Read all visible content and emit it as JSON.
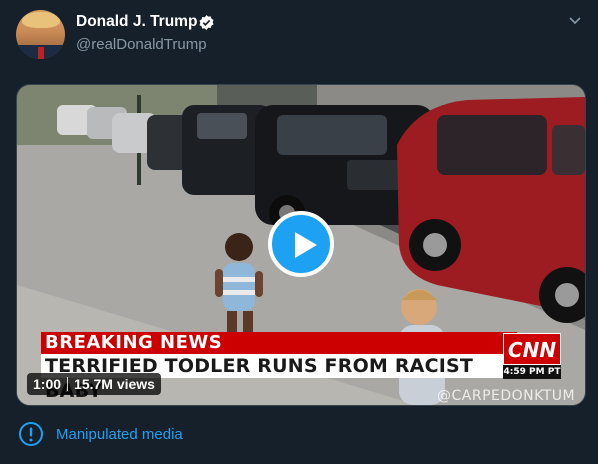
{
  "tweet": {
    "display_name": "Donald J. Trump",
    "handle": "@realDonaldTrump",
    "verified": true,
    "avatar_icon": "avatar-photo",
    "menu_icon": "chevron-down-icon"
  },
  "video": {
    "banner_top": "BREAKING NEWS",
    "banner_bottom": "TERRIFIED TODLER RUNS FROM RACIST BABY",
    "network_logo": "CNN",
    "time": "4:59 PM PT",
    "watermark": "@CARPEDONKTUM",
    "duration": "1:00",
    "views": "15.7M views",
    "play_icon": "play-icon"
  },
  "notice": {
    "label": "Manipulated media",
    "icon": "exclamation-icon"
  },
  "colors": {
    "background": "#15202b",
    "accent": "#1da1f2",
    "secondary_text": "#8899a6",
    "cnn_red": "#cc0000"
  }
}
